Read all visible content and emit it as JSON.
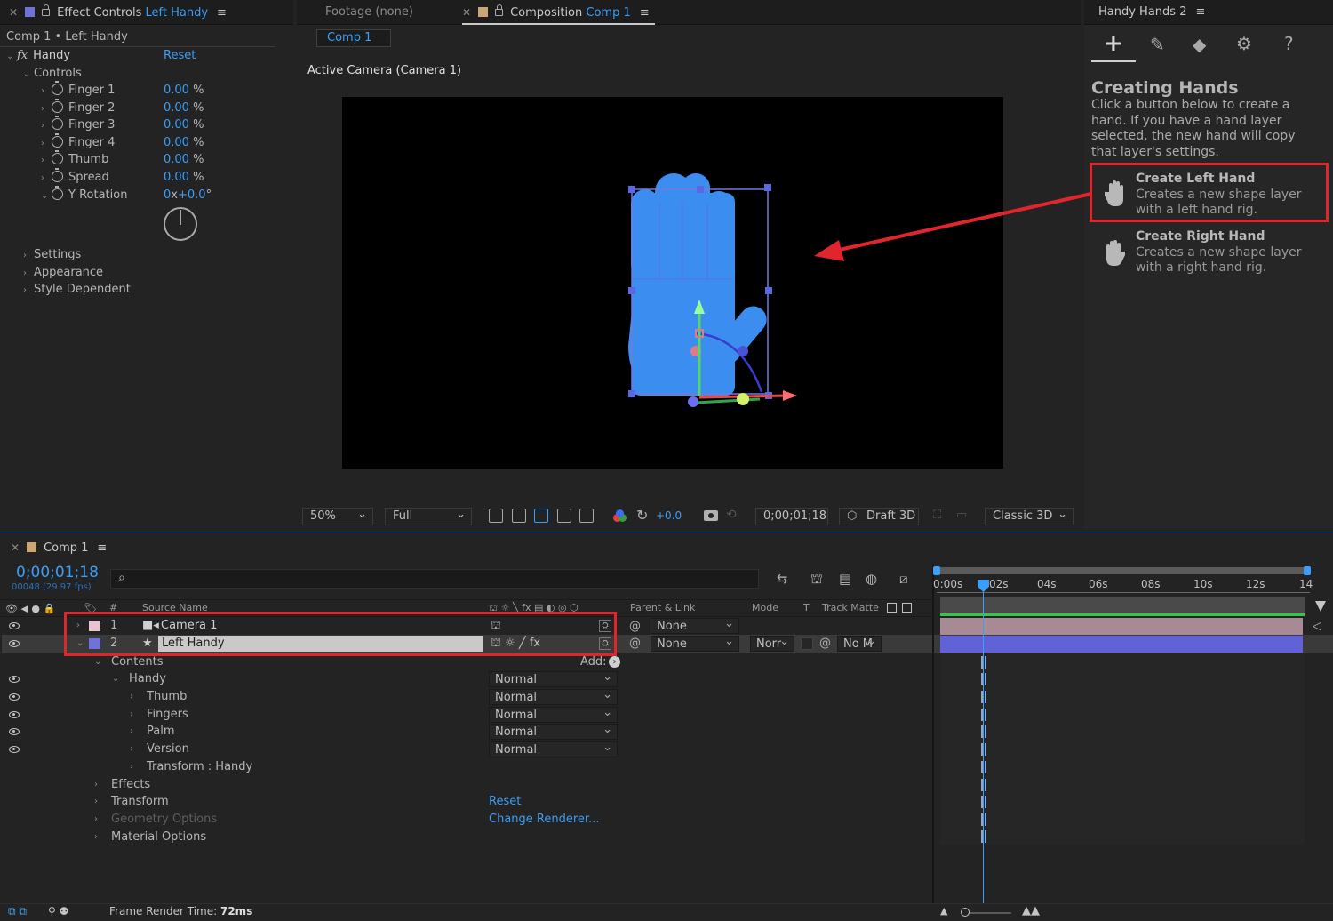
{
  "effect_controls": {
    "tab_label": "Effect Controls",
    "tab_target": "Left Handy",
    "breadcrumb": "Comp 1 • Left Handy",
    "fx_name": "Handy",
    "reset": "Reset",
    "controls_label": "Controls",
    "params": [
      {
        "name": "Finger 1",
        "value": "0.00",
        "unit": "%"
      },
      {
        "name": "Finger 2",
        "value": "0.00",
        "unit": "%"
      },
      {
        "name": "Finger 3",
        "value": "0.00",
        "unit": "%"
      },
      {
        "name": "Finger 4",
        "value": "0.00",
        "unit": "%"
      },
      {
        "name": "Thumb",
        "value": "0.00",
        "unit": "%"
      },
      {
        "name": "Spread",
        "value": "0.00",
        "unit": "%"
      }
    ],
    "rotation": {
      "name": "Y Rotation",
      "value_a": "0",
      "x": "x",
      "value_b": "+0.0",
      "unit": "°"
    },
    "groups": [
      "Settings",
      "Appearance",
      "Style Dependent"
    ]
  },
  "viewer": {
    "footage_tab": "Footage  (none)",
    "comp_tab_label": "Composition",
    "comp_tab_name": "Comp 1",
    "comp_chip": "Comp 1",
    "camera_label": "Active Camera (Camera 1)",
    "zoom": "50%",
    "resolution": "Full",
    "exposure": "+0.0",
    "timecode": "0;00;01;18",
    "renderer": "Draft 3D",
    "mode_3d": "Classic 3D"
  },
  "handy_panel": {
    "tab_label": "Handy Hands 2",
    "heading": "Creating Hands",
    "description": "Click a button below to create a hand. If you have a hand layer selected, the new hand will copy that layer's settings.",
    "buttons": [
      {
        "title": "Create Left Hand",
        "desc": "Creates a new shape layer with a left hand rig."
      },
      {
        "title": "Create Right Hand",
        "desc": "Creates a new shape layer with a right hand rig."
      }
    ]
  },
  "timeline": {
    "tab_label": "Comp 1",
    "timecode": "0;00;01;18",
    "frame_info": "00048 (29.97 fps)",
    "headers": {
      "hash": "#",
      "source": "Source Name",
      "parent": "Parent & Link",
      "mode": "Mode",
      "t": "T",
      "track": "Track Matte"
    },
    "layers": [
      {
        "num": "1",
        "name": "Camera 1",
        "parent": "None",
        "color": "#e8c4d0"
      },
      {
        "num": "2",
        "name": "Left Handy",
        "parent": "None",
        "mode": "Norr",
        "matte": "No M",
        "color": "#6f72d8"
      }
    ],
    "contents_label": "Contents",
    "add_label": "Add:",
    "children": [
      {
        "name": "Handy",
        "mode": "Normal"
      },
      {
        "name": "Thumb",
        "mode": "Normal"
      },
      {
        "name": "Fingers",
        "mode": "Normal"
      },
      {
        "name": "Palm",
        "mode": "Normal"
      },
      {
        "name": "Version",
        "mode": "Normal"
      },
      {
        "name": "Transform : Handy"
      }
    ],
    "extra": [
      "Effects",
      "Transform",
      "Geometry Options",
      "Material Options"
    ],
    "transform_reset": "Reset",
    "change_renderer": "Change Renderer...",
    "ruler": [
      "0:00s",
      "02s",
      "04s",
      "06s",
      "08s",
      "10s",
      "12s",
      "14"
    ],
    "render_time_label": "Frame Render Time:",
    "render_time_value": "72ms"
  },
  "colors": {
    "accent": "#3c9ef6",
    "highlight": "#e0252d",
    "hand": "#3b8ef0"
  }
}
